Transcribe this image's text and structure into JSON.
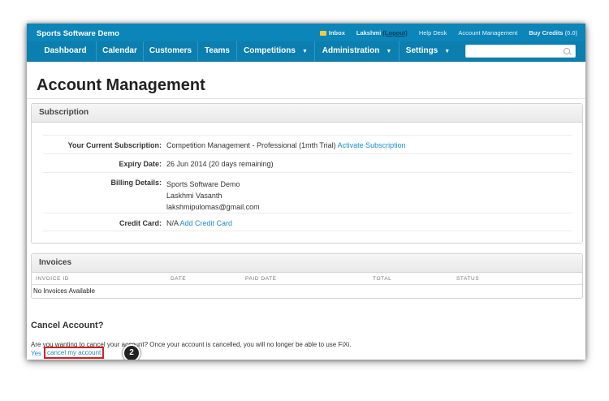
{
  "header": {
    "brand": "Sports Software Demo",
    "inbox_label": "Inbox",
    "user_name": "Lakshmi",
    "logout_label": "(Logout)",
    "help_desk_label": "Help Desk",
    "account_management_label": "Account Management",
    "buy_credits_label": "Buy Credits",
    "credits_value": "(0.0)"
  },
  "nav": {
    "items": [
      {
        "label": "Dashboard"
      },
      {
        "label": "Calendar"
      },
      {
        "label": "Customers"
      },
      {
        "label": "Teams"
      },
      {
        "label": "Competitions",
        "dropdown": true
      },
      {
        "label": "Administration",
        "dropdown": true
      },
      {
        "label": "Settings",
        "dropdown": true
      }
    ],
    "search_placeholder": ""
  },
  "page": {
    "title": "Account Management"
  },
  "subscription": {
    "heading": "Subscription",
    "current_label": "Your Current Subscription:",
    "current_value": "Competition Management - Professional (1mth Trial)",
    "activate_link": "Activate Subscription",
    "expiry_label": "Expiry Date:",
    "expiry_value": "26 Jun 2014  (20 days remaining)",
    "billing_label": "Billing Details:",
    "billing_lines": [
      "Sports Software Demo",
      "Laskhmi Vasanth",
      "lakshmipulomas@gmail.com"
    ],
    "credit_card_label": "Credit Card:",
    "credit_card_value": "N/A",
    "add_card_link": "Add Credit Card"
  },
  "invoices": {
    "heading": "Invoices",
    "columns": [
      "INVOICE ID",
      "DATE",
      "PAID DATE",
      "TOTAL",
      "STATUS"
    ],
    "empty_text": "No Invoices Available"
  },
  "cancel": {
    "heading": "Cancel Account?",
    "prompt": "Are you wanting to cancel your account? Once your account is cancelled, you will no longer be able to use FiXi.",
    "yes_label": "Yes",
    "link_label": "cancel my account",
    "step_number": "2"
  }
}
